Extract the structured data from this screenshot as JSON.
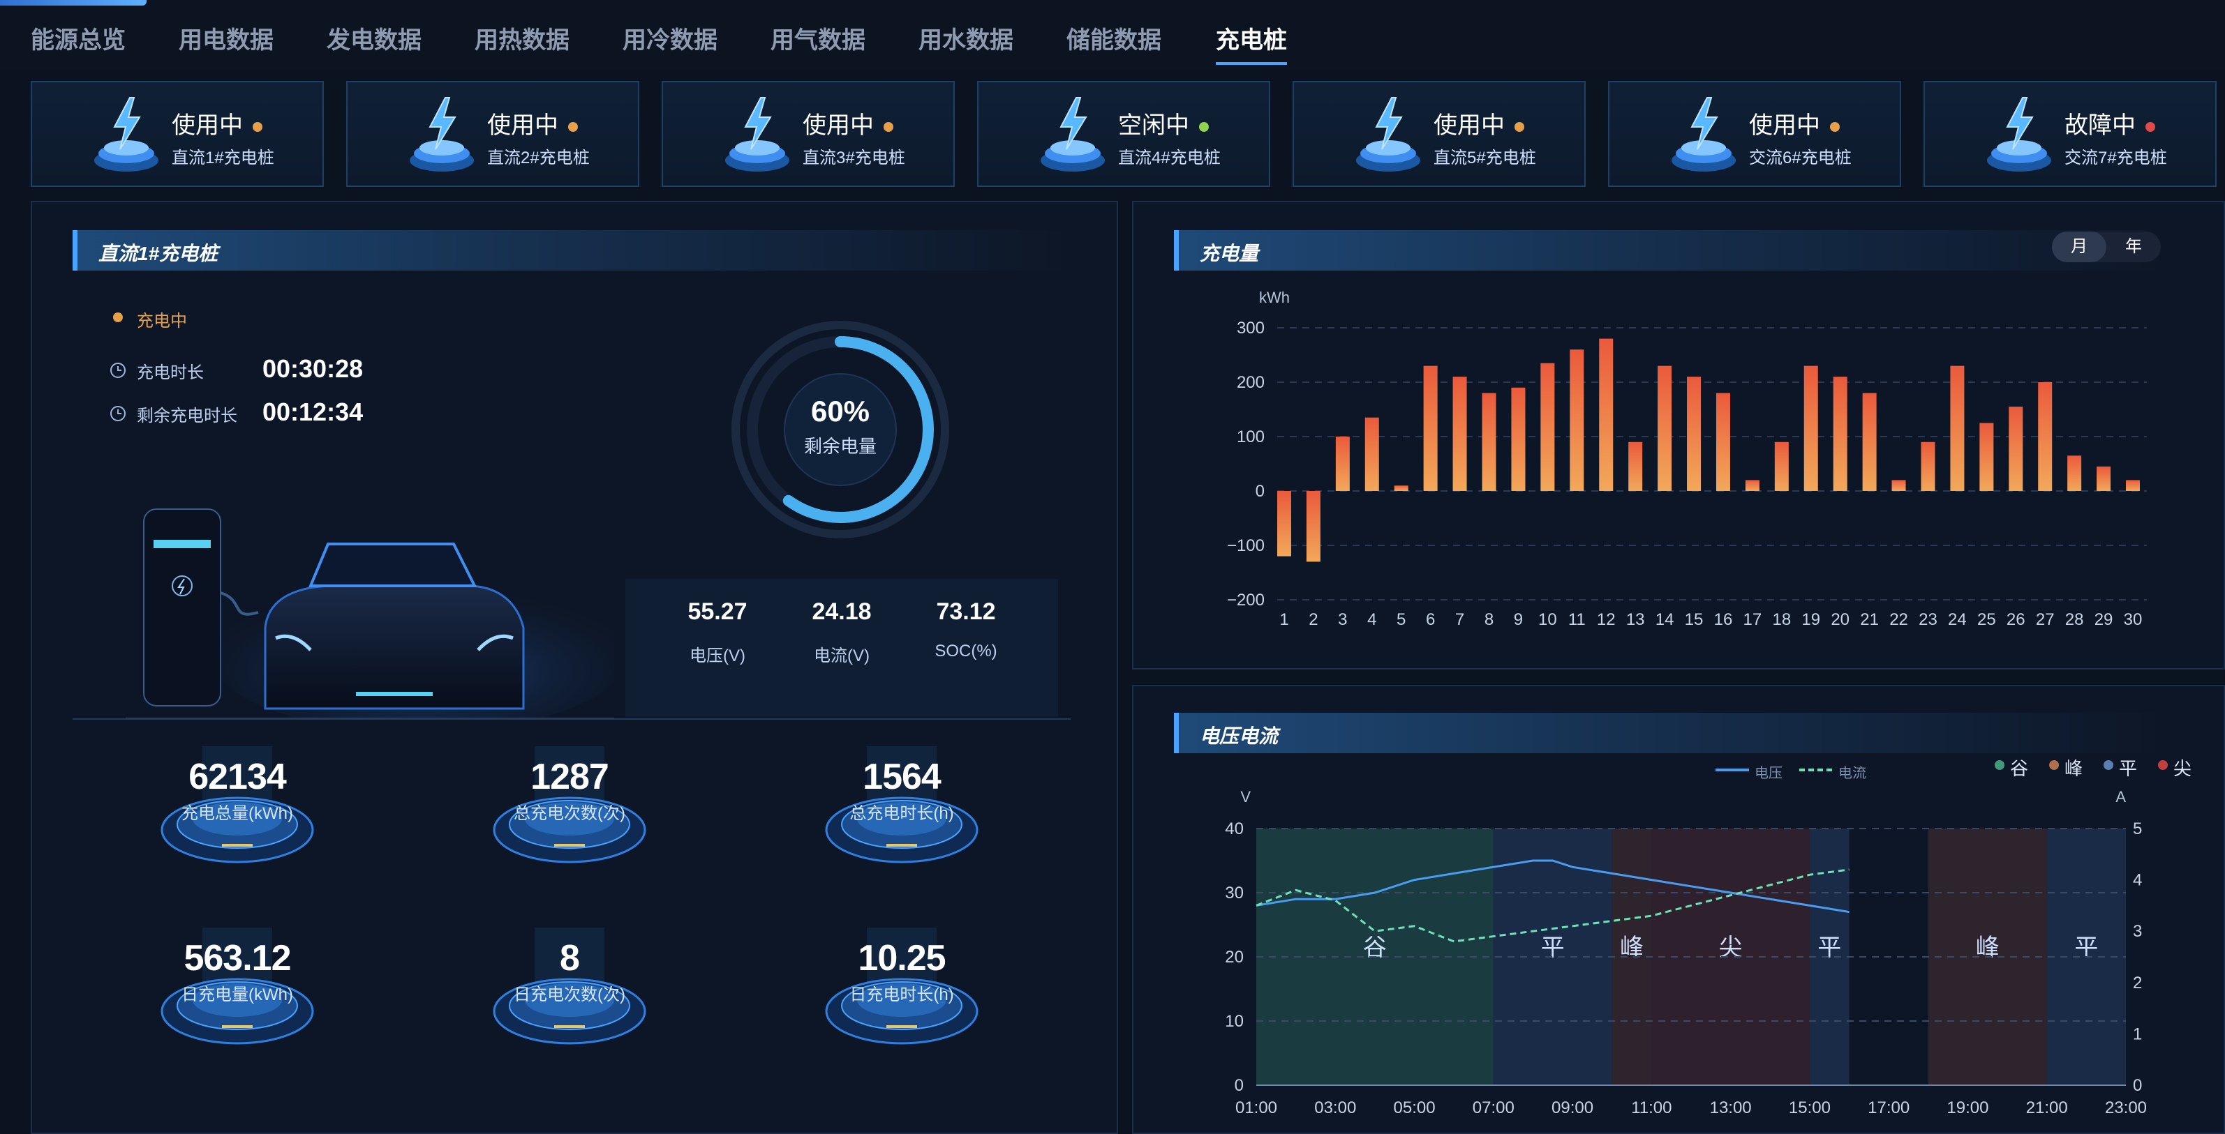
{
  "nav": {
    "tabs": [
      {
        "label": "能源总览"
      },
      {
        "label": "用电数据"
      },
      {
        "label": "发电数据"
      },
      {
        "label": "用热数据"
      },
      {
        "label": "用冷数据"
      },
      {
        "label": "用气数据"
      },
      {
        "label": "用水数据"
      },
      {
        "label": "储能数据"
      },
      {
        "label": "充电桩"
      }
    ],
    "active": "充电桩"
  },
  "stations": [
    {
      "status": "使用中",
      "name": "直流1#充电桩",
      "status_color": "#e6a04a"
    },
    {
      "status": "使用中",
      "name": "直流2#充电桩",
      "status_color": "#e6a04a"
    },
    {
      "status": "使用中",
      "name": "直流3#充电桩",
      "status_color": "#e6a04a"
    },
    {
      "status": "空闲中",
      "name": "直流4#充电桩",
      "status_color": "#8fd44a"
    },
    {
      "status": "使用中",
      "name": "直流5#充电桩",
      "status_color": "#e6a04a"
    },
    {
      "status": "使用中",
      "name": "交流6#充电桩",
      "status_color": "#e6a04a"
    },
    {
      "status": "故障中",
      "name": "交流7#充电桩",
      "status_color": "#e04a4a"
    }
  ],
  "detail": {
    "title": "直流1#充电桩",
    "status": "充电中",
    "charge_time_label": "充电时长",
    "charge_time": "00:30:28",
    "remaining_label": "剩余充电时长",
    "remaining": "00:12:34",
    "soc_percent": "60%",
    "soc_fraction": 0.6,
    "soc_label": "剩余电量",
    "metrics": [
      {
        "value": "55.27",
        "label": "电压(V)"
      },
      {
        "value": "24.18",
        "label": "电流(V)"
      },
      {
        "value": "73.12",
        "label": "SOC(%)"
      }
    ],
    "stats": [
      {
        "value": "62134",
        "label": "充电总量(kWh)"
      },
      {
        "value": "1287",
        "label": "总充电次数(次)"
      },
      {
        "value": "1564",
        "label": "总充电时长(h)"
      },
      {
        "value": "563.12",
        "label": "日充电量(kWh)"
      },
      {
        "value": "8",
        "label": "日充电次数(次)"
      },
      {
        "value": "10.25",
        "label": "日充电时长(h)"
      }
    ]
  },
  "energy_panel": {
    "title": "充电量",
    "toggle_month": "月",
    "toggle_year": "年"
  },
  "vi_panel": {
    "title": "电压电流",
    "legend_voltage": "电压",
    "legend_current": "电流",
    "period_legend": [
      {
        "label": "谷",
        "color": "#3f9a7a"
      },
      {
        "label": "峰",
        "color": "#b0704a"
      },
      {
        "label": "平",
        "color": "#5a7fb0"
      },
      {
        "label": "尖",
        "color": "#c04040"
      }
    ]
  },
  "chart_data": [
    {
      "type": "bar",
      "title": "充电量",
      "ylabel": "kWh",
      "categories": [
        "1",
        "2",
        "3",
        "4",
        "5",
        "6",
        "7",
        "8",
        "9",
        "10",
        "11",
        "12",
        "13",
        "14",
        "15",
        "16",
        "17",
        "18",
        "19",
        "20",
        "21",
        "22",
        "23",
        "24",
        "25",
        "26",
        "27",
        "28",
        "29",
        "30"
      ],
      "values": [
        -120,
        -130,
        100,
        135,
        10,
        230,
        210,
        180,
        190,
        235,
        260,
        280,
        90,
        230,
        210,
        180,
        20,
        90,
        230,
        210,
        180,
        20,
        90,
        230,
        125,
        155,
        200,
        65,
        45,
        20
      ],
      "ylim": [
        -200,
        300
      ],
      "yticks": [
        "300",
        "200",
        "100",
        "0",
        "−100",
        "−200"
      ],
      "grid": true
    },
    {
      "type": "line",
      "title": "电压电流",
      "ylabel": "V",
      "y2label": "A",
      "x": [
        "01:00",
        "02:00",
        "03:00",
        "04:00",
        "05:00",
        "06:00",
        "07:00",
        "08:00",
        "08:30",
        "09:00",
        "10:00",
        "11:00",
        "12:00",
        "13:00",
        "14:00",
        "15:00",
        "16:00"
      ],
      "series": [
        {
          "name": "电压",
          "values": [
            28,
            29,
            29,
            30,
            32,
            33,
            34,
            35,
            35,
            34,
            33,
            32,
            31,
            30,
            29,
            28,
            27
          ]
        },
        {
          "name": "电流",
          "values": [
            3.5,
            3.8,
            3.6,
            3.0,
            3.1,
            2.8,
            2.9,
            3.0,
            3.05,
            3.1,
            3.2,
            3.3,
            3.5,
            3.7,
            3.9,
            4.1,
            4.2
          ]
        }
      ],
      "xticks": [
        "01:00",
        "03:00",
        "05:00",
        "07:00",
        "09:00",
        "11:00",
        "13:00",
        "15:00",
        "17:00",
        "19:00",
        "21:00",
        "23:00"
      ],
      "ylim": [
        0,
        40
      ],
      "yticks": [
        "40",
        "30",
        "20",
        "10",
        "0"
      ],
      "y2lim": [
        0,
        5
      ],
      "y2ticks": [
        "5",
        "4",
        "3",
        "2",
        "1",
        "0"
      ],
      "periods": [
        {
          "label": "谷",
          "start": 1,
          "end": 7
        },
        {
          "label": "平",
          "start": 7,
          "end": 10
        },
        {
          "label": "峰",
          "start": 10,
          "end": 11
        },
        {
          "label": "尖",
          "start": 11,
          "end": 15
        },
        {
          "label": "平",
          "start": 15,
          "end": 16
        },
        {
          "label": "峰",
          "start": 18,
          "end": 21
        },
        {
          "label": "平",
          "start": 21,
          "end": 24
        }
      ]
    }
  ]
}
